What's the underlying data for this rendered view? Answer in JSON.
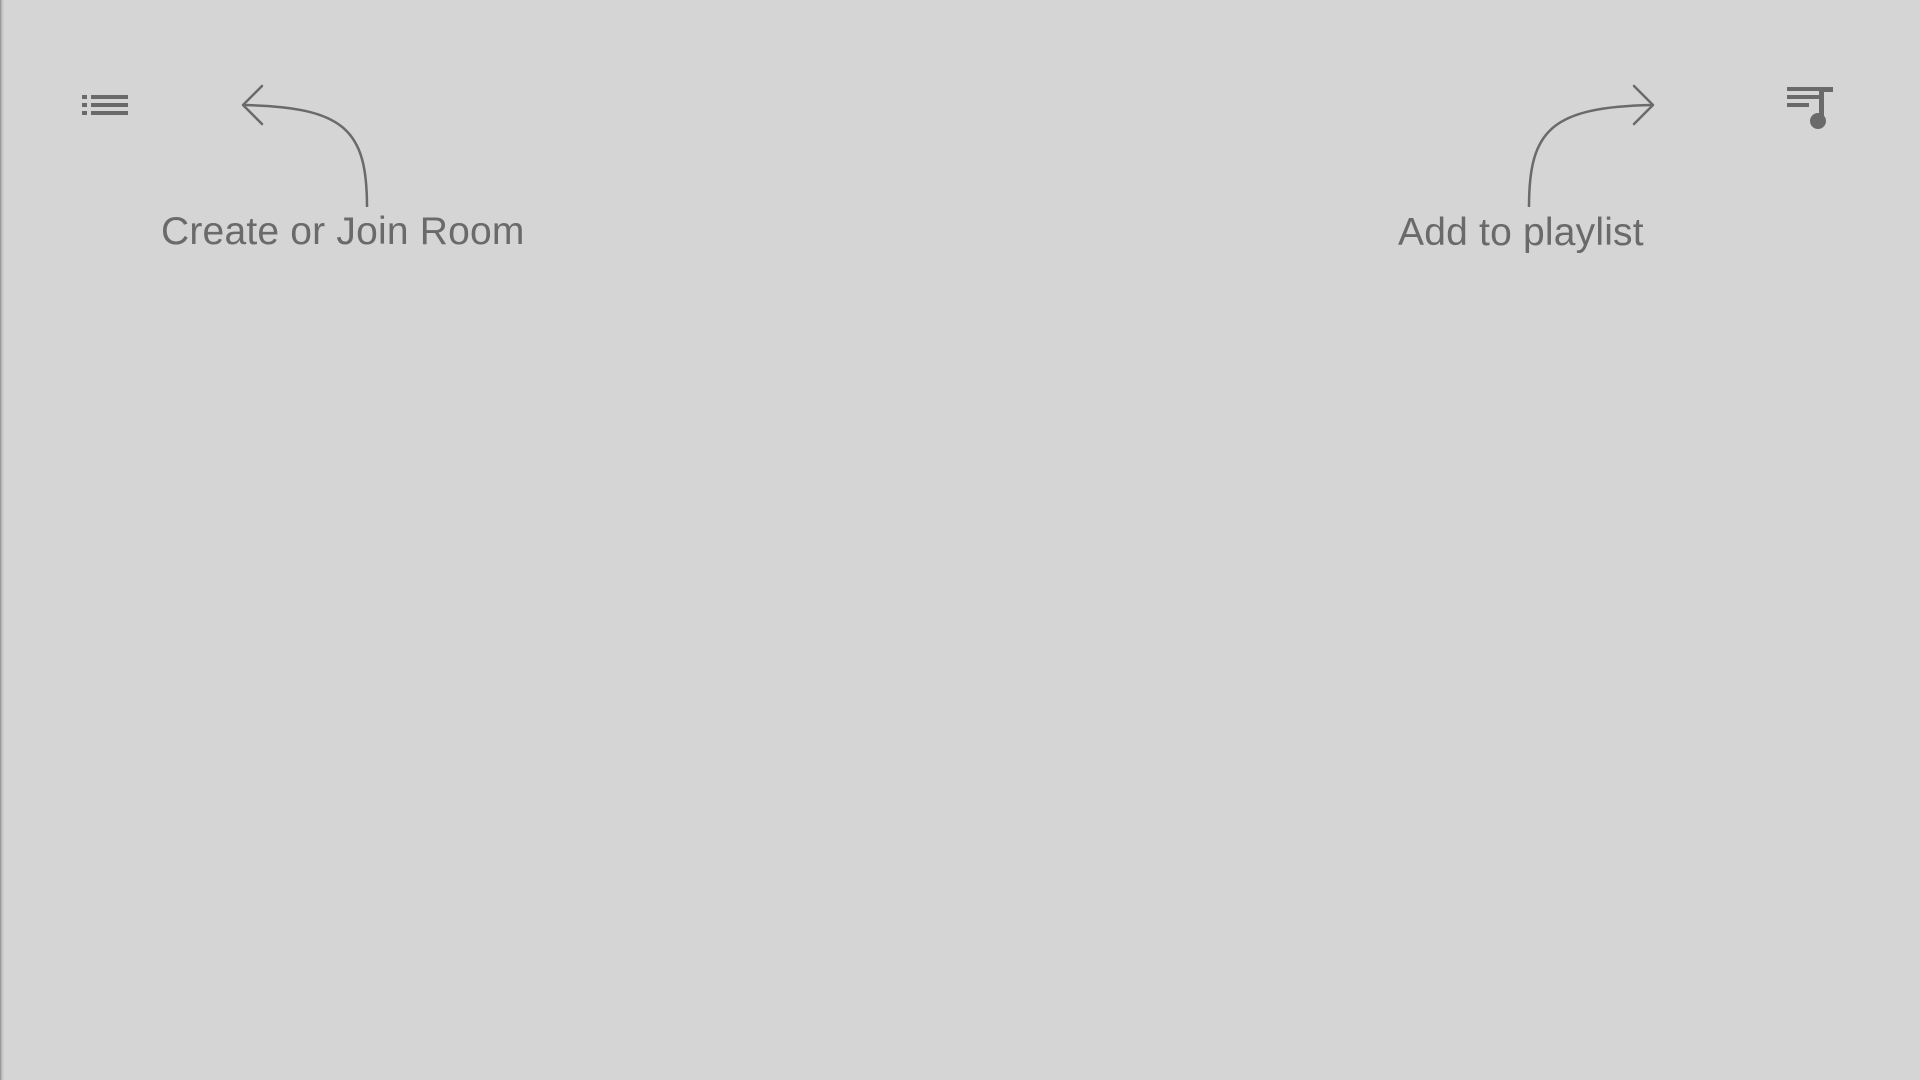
{
  "toolbar": {
    "rooms_button_icon": "list-icon",
    "playlist_button_icon": "queue-music-icon"
  },
  "hints": {
    "rooms": "Create or Join Room",
    "playlist": "Add to playlist"
  },
  "colors": {
    "background": "#d5d5d5",
    "foreground": "#6a6a6a"
  }
}
